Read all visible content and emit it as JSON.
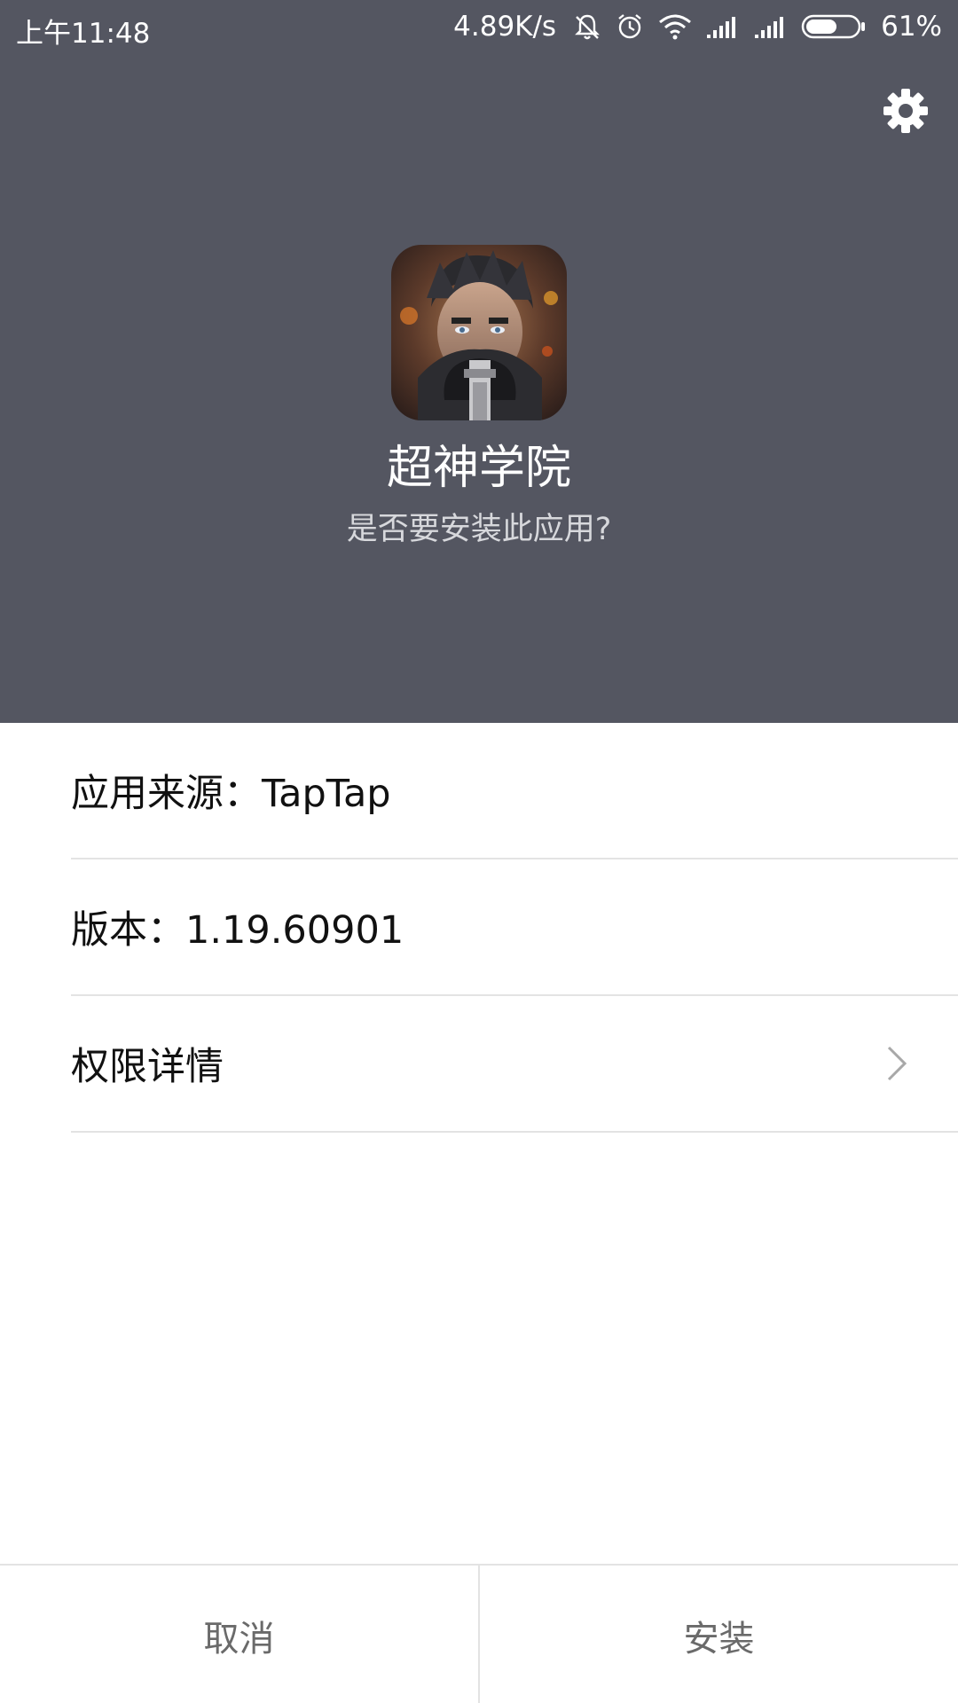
{
  "status_bar": {
    "time": "上午11:48",
    "net_speed": "4.89K/s",
    "battery_percent": "61%",
    "battery_level": 0.61,
    "icons": [
      "mute-bell-icon",
      "alarm-icon",
      "wifi-icon",
      "signal-icon",
      "signal-icon",
      "battery-icon"
    ]
  },
  "header": {
    "background_color": "#545661",
    "settings_icon": "gear-icon",
    "app_icon": "game-app-icon",
    "app_name": "超神学院",
    "question": "是否要安装此应用?"
  },
  "info_list": {
    "items": [
      {
        "label": "应用来源：TapTap",
        "has_chevron": false
      },
      {
        "label": "版本：1.19.60901",
        "has_chevron": false
      },
      {
        "label": "权限详情",
        "has_chevron": true,
        "icon": "chevron-right-icon"
      }
    ]
  },
  "bottom_bar": {
    "cancel_label": "取消",
    "install_label": "安装"
  }
}
